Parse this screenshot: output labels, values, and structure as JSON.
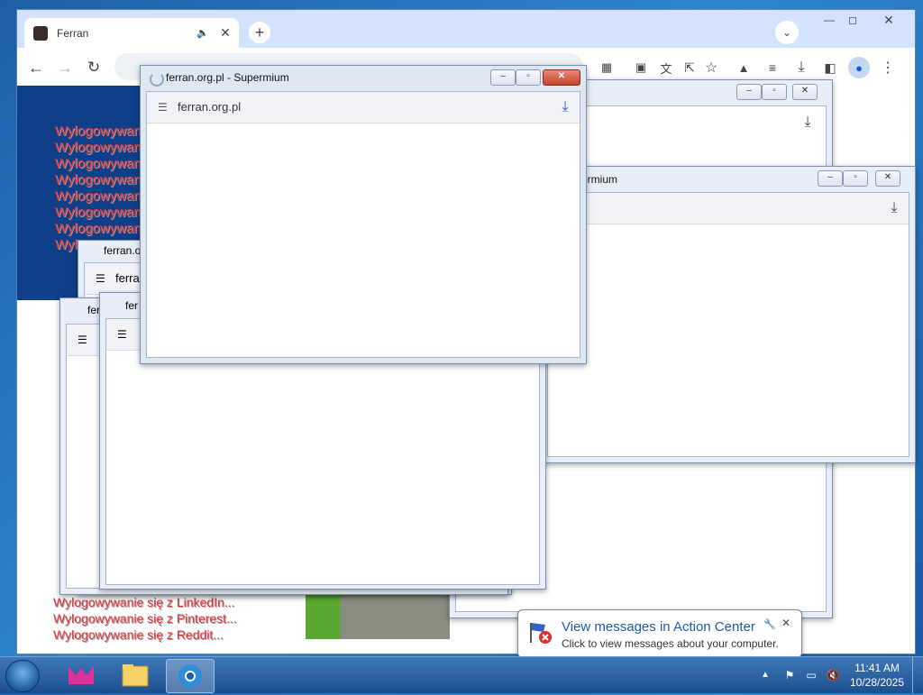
{
  "browser": {
    "tab_title": "Ferran",
    "window_controls": [
      "minimize",
      "restore",
      "close"
    ]
  },
  "page": {
    "lines_top": [
      "Wylogowywanie",
      "Wylogowywanie",
      "Wylogowywanie",
      "Wylogowywanie",
      "Wylogowywanie",
      "Wylogowywanie",
      "Wylogowywanie",
      "Wylogowywanie"
    ],
    "lines_bottom": [
      "Wylogowywanie się z LinkedIn...",
      "Wylogowywanie się z Pinterest...",
      "Wylogowywanie się z Reddit..."
    ]
  },
  "popup_front": {
    "title": "ferran.org.pl - Supermium",
    "url": "ferran.org.pl"
  },
  "popup_right": {
    "title": "ermium"
  },
  "popup_left1": {
    "title": "ferran.o",
    "url": "ferra"
  },
  "popup_left2": {
    "title": "fer"
  },
  "popup_left3": {
    "title": "fer"
  },
  "balloon": {
    "title": "View messages in Action Center",
    "subtitle": "Click to view messages about your computer."
  },
  "clock": {
    "time": "11:41 AM",
    "date": "10/28/2025"
  }
}
